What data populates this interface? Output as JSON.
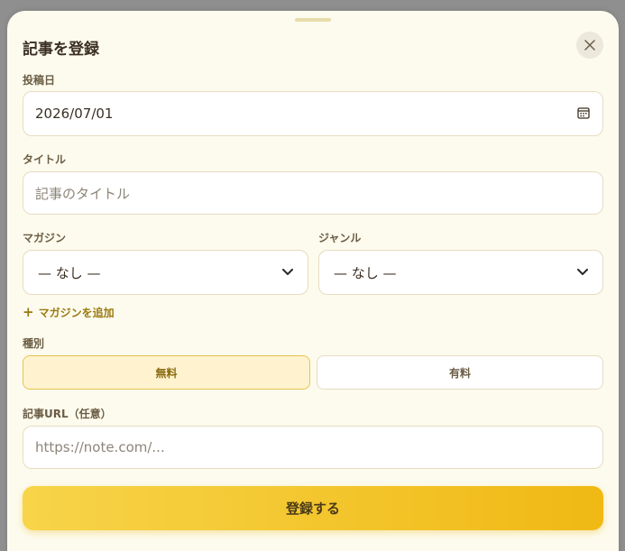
{
  "modal": {
    "title": "記事を登録",
    "close_icon": "close-icon"
  },
  "form": {
    "date": {
      "label": "投稿日",
      "value": "2026/07/01",
      "icon": "calendar-icon"
    },
    "title_field": {
      "label": "タイトル",
      "placeholder": "記事のタイトル"
    },
    "magazine": {
      "label": "マガジン",
      "selected": "— なし —"
    },
    "genre": {
      "label": "ジャンル",
      "selected": "— なし —"
    },
    "add_magazine": {
      "label": "マガジンを追加",
      "icon": "plus-icon"
    },
    "type": {
      "label": "種別",
      "options": [
        {
          "label": "無料",
          "active": true
        },
        {
          "label": "有料",
          "active": false
        }
      ]
    },
    "url_field": {
      "label": "記事URL（任意）",
      "placeholder": "https://note.com/..."
    },
    "submit_label": "登録する"
  },
  "colors": {
    "accent": "#f0b914",
    "accent_light": "#fff3cf",
    "background": "#fdfbee"
  }
}
